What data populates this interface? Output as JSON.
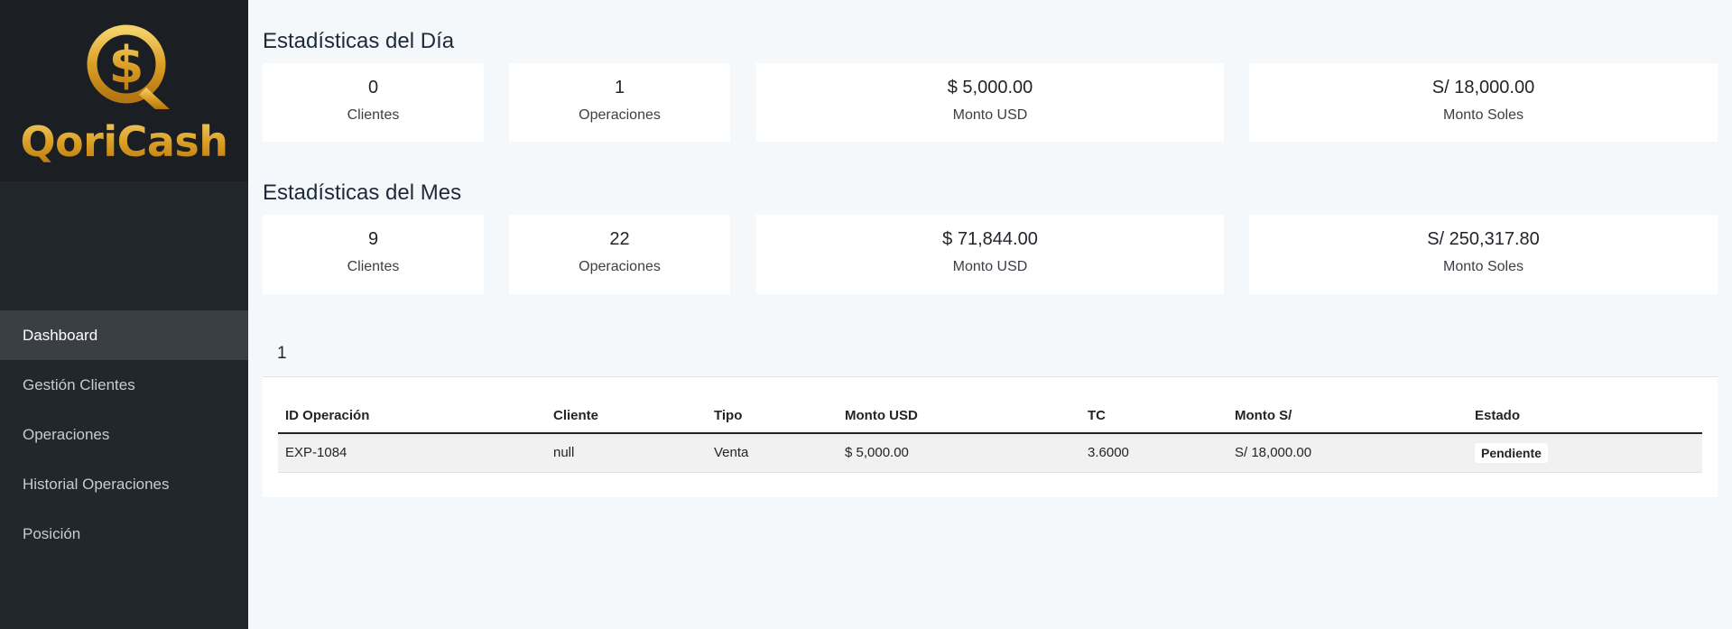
{
  "sidebar": {
    "brand": "QoriCash",
    "brand_color": "#d4a12a",
    "nav": [
      {
        "label": "Dashboard",
        "active": true
      },
      {
        "label": "Gestión Clientes",
        "active": false
      },
      {
        "label": "Operaciones",
        "active": false
      },
      {
        "label": "Historial Operaciones",
        "active": false
      },
      {
        "label": "Posición",
        "active": false
      }
    ]
  },
  "day_stats": {
    "title": "Estadísticas del Día",
    "cards": [
      {
        "value": "0",
        "label": "Clientes"
      },
      {
        "value": "1",
        "label": "Operaciones"
      },
      {
        "value": "$ 5,000.00",
        "label": "Monto USD"
      },
      {
        "value": "S/ 18,000.00",
        "label": "Monto Soles"
      }
    ]
  },
  "month_stats": {
    "title": "Estadísticas del Mes",
    "cards": [
      {
        "value": "9",
        "label": "Clientes"
      },
      {
        "value": "22",
        "label": "Operaciones"
      },
      {
        "value": "$ 71,844.00",
        "label": "Monto USD"
      },
      {
        "value": "S/ 250,317.80",
        "label": "Monto Soles"
      }
    ]
  },
  "operations": {
    "header": "1",
    "columns": [
      "ID Operación",
      "Cliente",
      "Tipo",
      "Monto USD",
      "TC",
      "Monto S/",
      "Estado"
    ],
    "rows": [
      [
        "EXP-1084",
        "null",
        "Venta",
        "$ 5,000.00",
        "3.6000",
        "S/ 18,000.00",
        "Pendiente"
      ]
    ]
  }
}
